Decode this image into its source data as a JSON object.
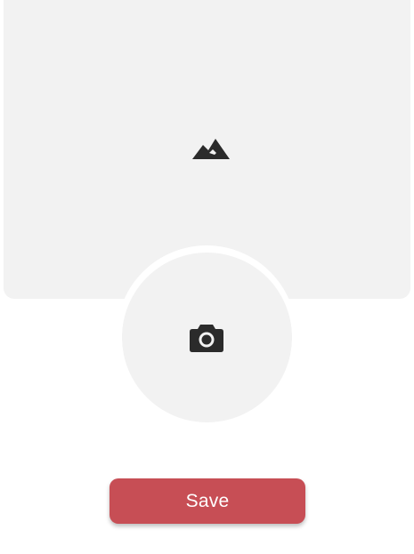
{
  "cover": {
    "icon": "mountains-icon",
    "background": "#f2f2f2",
    "icon_color": "#2b2b2b"
  },
  "avatar": {
    "icon": "camera-icon",
    "background": "#f2f2f2",
    "icon_color": "#2b2b2b"
  },
  "actions": {
    "save_label": "Save",
    "save_color": "#c74e55"
  }
}
